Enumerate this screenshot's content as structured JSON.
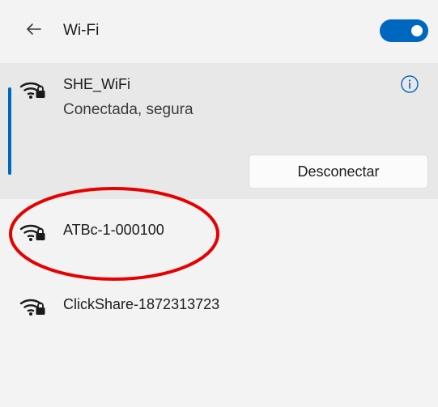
{
  "theme": {
    "accent": "#0067c0",
    "annotation": "#e60000"
  },
  "header": {
    "back_icon": "back-arrow-icon",
    "title": "Wi-Fi",
    "wifi_enabled": true
  },
  "connected_network": {
    "name": "SHE_WiFi",
    "status": "Conectada, segura",
    "icon": "wifi-secure-icon",
    "info_icon": "info-icon",
    "disconnect_label": "Desconectar"
  },
  "networks": [
    {
      "name": "ATBc-1-000100",
      "icon": "wifi-secure-icon",
      "highlighted": true
    },
    {
      "name": "ClickShare-1872313723",
      "icon": "wifi-secure-icon",
      "highlighted": false
    }
  ]
}
